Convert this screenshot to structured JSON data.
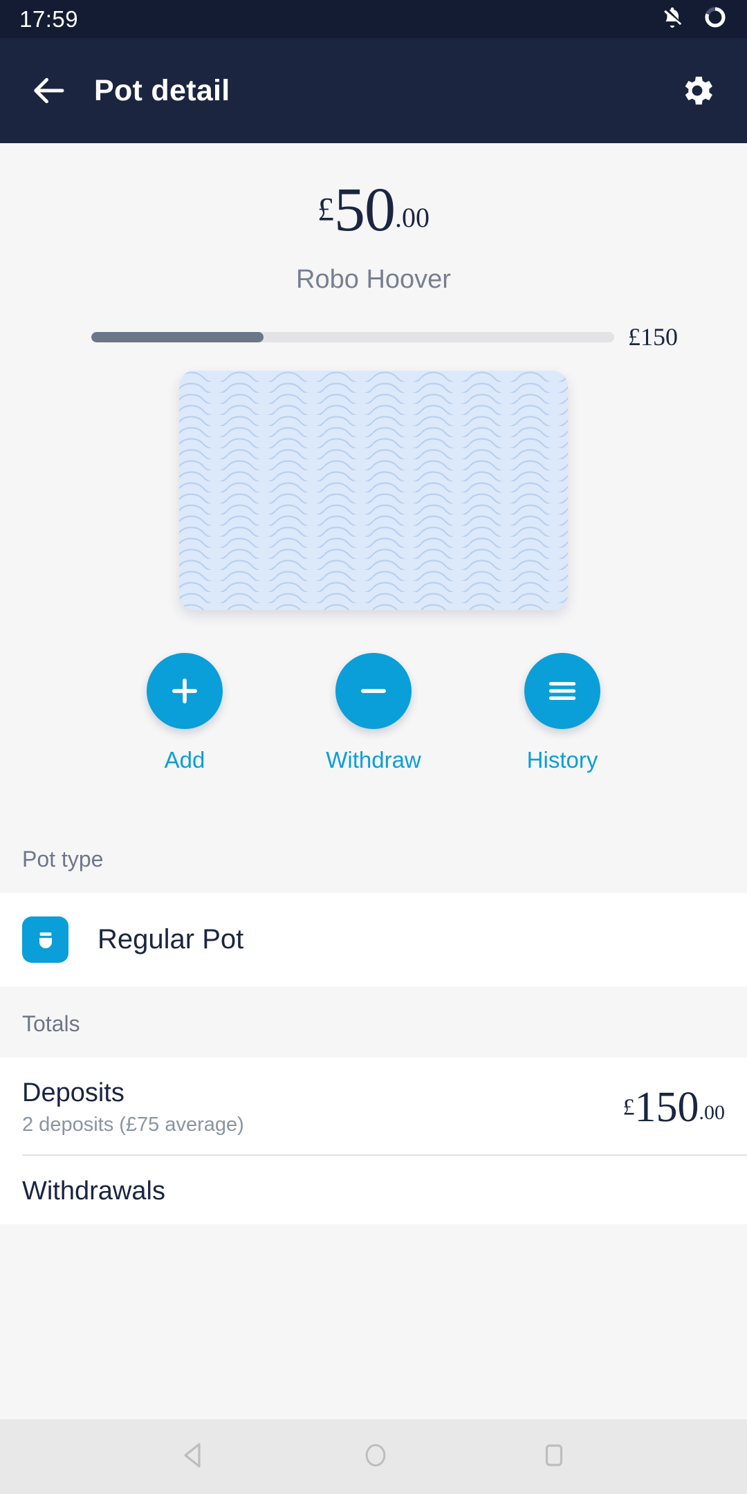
{
  "status_bar": {
    "time": "17:59",
    "icons": [
      "notifications-off-icon",
      "battery-ring-icon"
    ]
  },
  "app_bar": {
    "back_icon": "arrow-left-icon",
    "title": "Pot detail",
    "settings_icon": "gear-icon"
  },
  "pot": {
    "balance_currency": "£",
    "balance_integer": "50",
    "balance_decimal": ".00",
    "name": "Robo Hoover",
    "goal_label": "£150",
    "progress_percent": 33,
    "image_alt": "wave-pattern-card"
  },
  "actions": [
    {
      "icon": "plus-icon",
      "label": "Add"
    },
    {
      "icon": "minus-icon",
      "label": "Withdraw"
    },
    {
      "icon": "list-icon",
      "label": "History"
    }
  ],
  "pot_type": {
    "section_title": "Pot type",
    "icon": "pot-icon",
    "label": "Regular Pot"
  },
  "totals": {
    "section_title": "Totals",
    "rows": [
      {
        "title": "Deposits",
        "subtitle": "2 deposits (£75 average)",
        "currency": "£",
        "integer": "150",
        "decimal": ".00"
      },
      {
        "title": "Withdrawals",
        "subtitle": "",
        "currency": "",
        "integer": "",
        "decimal": ""
      }
    ]
  },
  "nav_bar": {
    "back_icon": "nav-back-triangle-icon",
    "home_icon": "nav-home-circle-icon",
    "recents_icon": "nav-recents-square-icon"
  },
  "colors": {
    "app_bar": "#1b2540",
    "status_bar": "#141c33",
    "accent": "#0a9fd8",
    "background": "#f6f6f7",
    "card": "#dce9fb",
    "progress_fill": "#6b7789",
    "progress_track": "#e3e3e5"
  }
}
